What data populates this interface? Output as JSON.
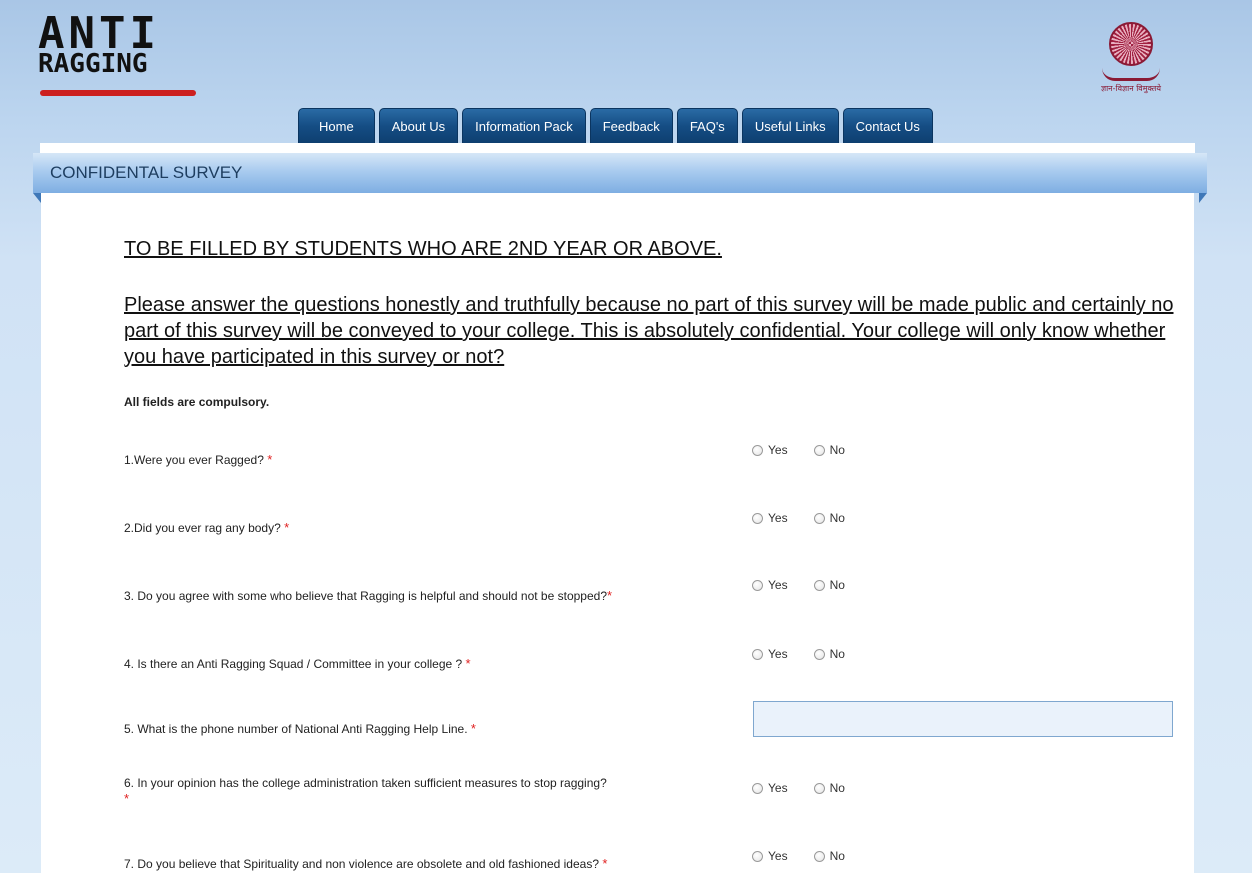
{
  "logo": {
    "line1": "ANTI",
    "line2": "RAGGING"
  },
  "emblem": {
    "caption": "ज्ञान-विज्ञान विमुक्तये",
    "icon": "ugc-emblem-icon"
  },
  "nav": [
    {
      "label": "Home"
    },
    {
      "label": "About Us"
    },
    {
      "label": "Information Pack"
    },
    {
      "label": "Feedback"
    },
    {
      "label": "FAQ's"
    },
    {
      "label": "Useful Links"
    },
    {
      "label": "Contact Us"
    }
  ],
  "section_title": "CONFIDENTAL SURVEY",
  "heading": "TO BE FILLED BY STUDENTS WHO ARE 2ND YEAR OR ABOVE.",
  "notice": "Please answer the questions honestly and truthfully because no part of this survey will be made public and certainly no part of this survey will be conveyed to your college. This is absolutely confidential. Your college will only know whether you have participated in this survey or not?",
  "required_note": "All fields are compulsory.",
  "options": {
    "yes": "Yes",
    "no": "No"
  },
  "asterisk": "*",
  "questions": [
    {
      "text": "1.Were you ever Ragged? "
    },
    {
      "text": "2.Did you ever rag any body? "
    },
    {
      "text": "3. Do you agree with some who believe that Ragging is helpful and should not be stopped?"
    },
    {
      "text": "4. Is there an Anti Ragging Squad / Committee in your college ? "
    },
    {
      "text": "5. What is the phone number of National Anti Ragging Help Line. ",
      "value": "",
      "placeholder": ""
    },
    {
      "text": "6. In your opinion has the college administration taken sufficient measures to stop ragging?"
    },
    {
      "text": "7. Do you believe that Spirituality and non violence are obsolete and old fashioned ideas? "
    }
  ],
  "colors": {
    "nav_tab": "#154d84",
    "header_bar": "#a9cbef",
    "asterisk": "#e02020",
    "logo_bar": "#cc1f1f"
  }
}
